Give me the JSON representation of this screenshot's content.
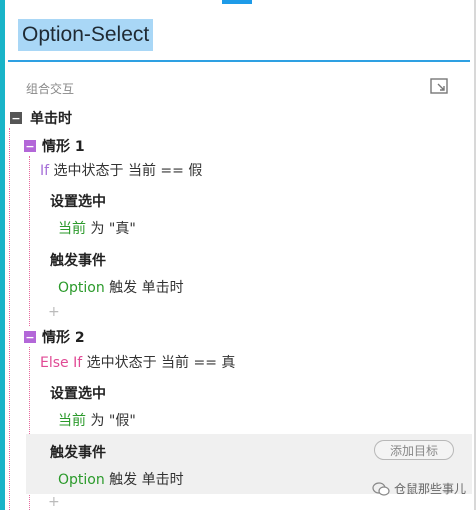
{
  "panel": {
    "title": "Option-Select",
    "section_label": "组合交互"
  },
  "event": {
    "toggle": "−",
    "label": "单击时"
  },
  "cases": [
    {
      "toggle": "−",
      "label": "情形 1",
      "condition_keyword": "If",
      "condition_text": "选中状态于 当前 == 假",
      "actions": [
        {
          "title": "设置选中",
          "target": "当前",
          "detail": " 为 \"真\""
        },
        {
          "title": "触发事件",
          "target": "Option",
          "detail": " 触发 单击时"
        }
      ],
      "add": "+"
    },
    {
      "toggle": "−",
      "label": "情形 2",
      "condition_keyword": "Else If",
      "condition_text": "选中状态于 当前 == 真",
      "actions": [
        {
          "title": "设置选中",
          "target": "当前",
          "detail": " 为 \"假\""
        },
        {
          "title": "触发事件",
          "target": "Option",
          "detail": " 触发 单击时",
          "add_target_label": "添加目标"
        }
      ],
      "add": "+"
    }
  ],
  "watermark": {
    "text": "仓鼠那些事儿"
  },
  "colors": {
    "accent_blue": "#2ea0e2",
    "title_highlight": "#a9d7f6",
    "left_rail": "#19b4c8",
    "if_keyword": "#a56fd8",
    "elseif_keyword": "#e04a95",
    "target_green": "#2b9a2b"
  }
}
